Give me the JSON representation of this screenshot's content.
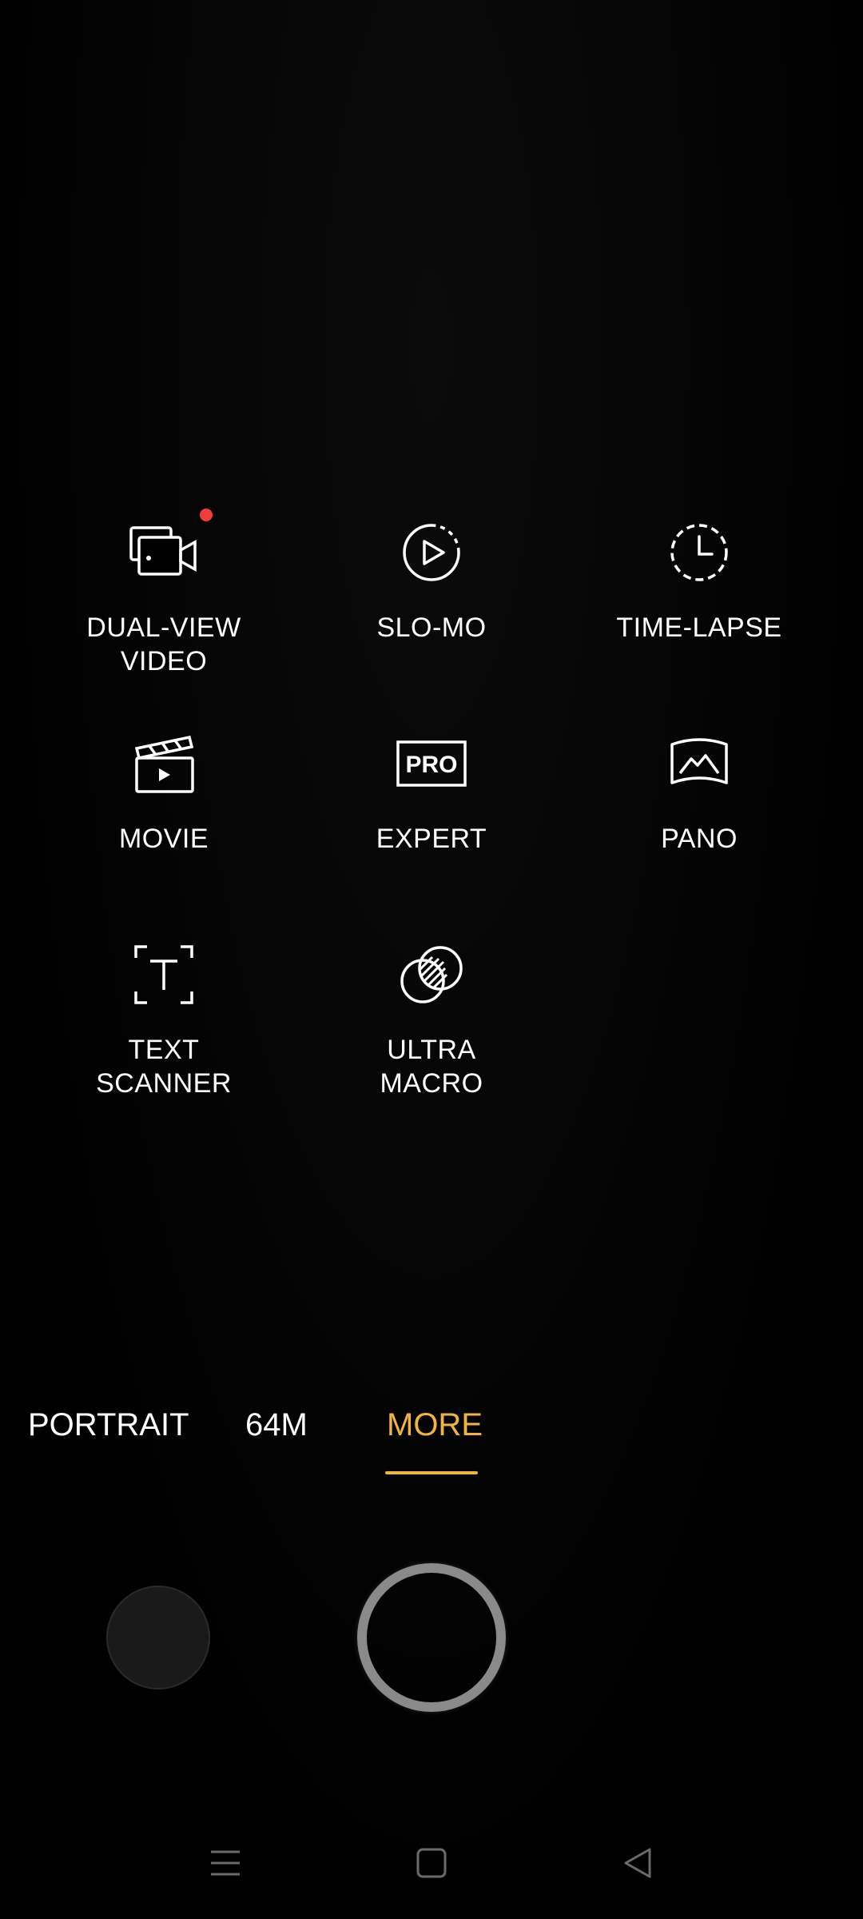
{
  "modes": [
    {
      "label": "DUAL-VIEW\nVIDEO",
      "icon": "dual-view-video-icon",
      "has_new_badge": true
    },
    {
      "label": "SLO-MO",
      "icon": "slow-motion-icon"
    },
    {
      "label": "TIME-LAPSE",
      "icon": "time-lapse-icon"
    },
    {
      "label": "MOVIE",
      "icon": "movie-clapper-icon"
    },
    {
      "label": "EXPERT",
      "icon": "pro-icon",
      "icon_text": "PRO"
    },
    {
      "label": "PANO",
      "icon": "panorama-icon"
    },
    {
      "label": "TEXT\nSCANNER",
      "icon": "text-scanner-icon",
      "icon_text": "T"
    },
    {
      "label": "ULTRA\nMACRO",
      "icon": "ultra-macro-icon"
    }
  ],
  "mode_strip": {
    "tabs": [
      {
        "label": "PORTRAIT"
      },
      {
        "label": "64M"
      },
      {
        "label": "MORE",
        "active": true
      }
    ]
  },
  "colors": {
    "accent": "#f0b53a",
    "badge": "#f23c3c",
    "background": "#000000",
    "shutter_ring": "#8a8a8a"
  },
  "navbar": {
    "icons": [
      "menu-icon",
      "home-icon",
      "back-icon"
    ]
  }
}
